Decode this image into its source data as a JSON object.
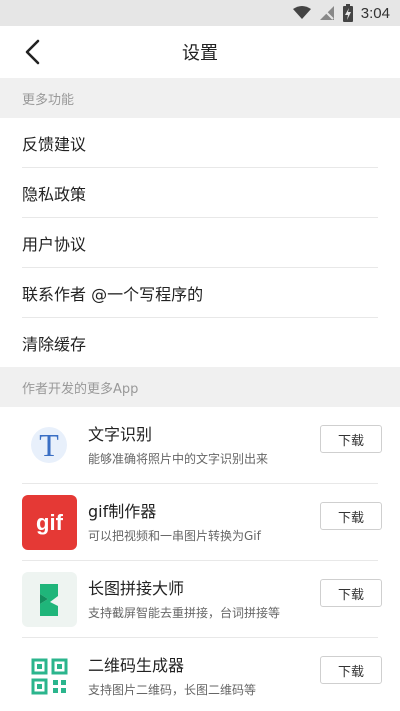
{
  "status_bar": {
    "time": "3:04"
  },
  "header": {
    "title": "设置"
  },
  "sections": {
    "more_features": "更多功能",
    "more_apps": "作者开发的更多App"
  },
  "menu": [
    {
      "label": "反馈建议"
    },
    {
      "label": "隐私政策"
    },
    {
      "label": "用户协议"
    },
    {
      "label": "联系作者 @一个写程序的"
    },
    {
      "label": "清除缓存"
    }
  ],
  "apps": [
    {
      "name": "文字识别",
      "desc": "能够准确将照片中的文字识别出来",
      "button": "下载",
      "icon": "text-recognition-icon"
    },
    {
      "name": "gif制作器",
      "desc": "可以把视频和一串图片转换为Gif",
      "button": "下载",
      "icon": "gif-maker-icon",
      "icon_text": "gif"
    },
    {
      "name": "长图拼接大师",
      "desc": "支持截屏智能去重拼接，台词拼接等",
      "button": "下载",
      "icon": "long-image-stitch-icon"
    },
    {
      "name": "二维码生成器",
      "desc": "支持图片二维码，长图二维码等",
      "button": "下载",
      "icon": "qr-code-icon"
    }
  ],
  "colors": {
    "section_bg": "#f0f0f0",
    "gif_red": "#e53935",
    "stitch_green": "#1fb57a",
    "qr_green": "#2bb58d"
  }
}
